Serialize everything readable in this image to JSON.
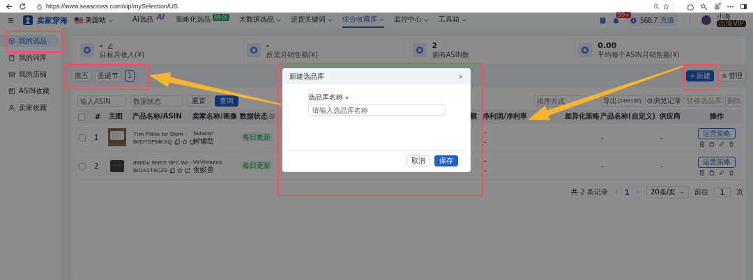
{
  "browser": {
    "url": "https://www.seascross.com/vip/mySelection/US"
  },
  "header": {
    "logo": "卖家穿海",
    "site": "美国站",
    "nav": [
      {
        "label": "AI选品",
        "badge": "AI",
        "caret": false,
        "selected": false
      },
      {
        "label": "策略化选品",
        "badge": "独创",
        "caret": false,
        "selected": false
      },
      {
        "label": "大数据选品",
        "caret": true,
        "selected": false
      },
      {
        "label": "进货关键词",
        "caret": true,
        "selected": false
      },
      {
        "label": "综合收藏库",
        "caret": true,
        "selected": true
      },
      {
        "label": "监控中心",
        "caret": true,
        "selected": false
      },
      {
        "label": "工具箱",
        "caret": true,
        "selected": false
      }
    ],
    "notifications": "99+",
    "balance": "568.7",
    "recharge": "充值",
    "user": "小海",
    "vip": "出海VIP"
  },
  "sidebar": {
    "items": [
      {
        "label": "我的选品",
        "selected": true
      },
      {
        "label": "我的词库",
        "selected": false
      },
      {
        "label": "我的店铺",
        "selected": false
      },
      {
        "label": "ASIN收藏",
        "selected": false
      },
      {
        "label": "卖家收藏",
        "selected": false
      }
    ]
  },
  "stats": [
    {
      "value": "-",
      "label": "目标月收入(¥)",
      "editable": true
    },
    {
      "value": "-",
      "label": "所需月销售额(¥)",
      "editable": false
    },
    {
      "value": "2",
      "label": "拥有ASIN数",
      "editable": false
    },
    {
      "value": "0.00",
      "label": "平均每个ASIN月销售额(¥)",
      "editable": false
    }
  ],
  "tags": [
    {
      "label": "黑五",
      "selected": false
    },
    {
      "label": "圣诞节",
      "selected": false
    },
    {
      "label": "1",
      "selected": true
    }
  ],
  "actions": {
    "new": "新建",
    "manage": "管理"
  },
  "filters": {
    "asin_placeholder": "输入ASIN",
    "status_placeholder": "数据状态",
    "reset": "重置",
    "search": "查询",
    "sort_placeholder": "排序方式",
    "export": "导出",
    "export_count": "(149/150)",
    "history": "浏览记录",
    "transfer": "转移选品库",
    "delete": "删除",
    "transfer_disabled": true,
    "delete_disabled": true
  },
  "table": {
    "header_checked": false,
    "columns": [
      "#",
      "主图",
      "产品名称/ASIN",
      "卖家名称/画像",
      "数据状态",
      "额",
      "净利润/净利率",
      "差异化策略",
      "产品名称(自定义)",
      "供应商",
      "操作"
    ],
    "rows": [
      {
        "checked": false,
        "index": "1",
        "name": "Thin Pillow for Stom···",
        "asin": "B0DYDPMKXQ",
        "seller": "Suhedy*",
        "persona": "树懒型",
        "status": "每日更新",
        "profit": "-",
        "margin": "-",
        "custom_name": "-",
        "supplier": "-",
        "op": "运营策略"
      },
      {
        "checked": false,
        "index": "2",
        "name": "8BitDo SNES SFC Wi···",
        "asin": "B01K1T9CZS",
        "seller": "VirVentures",
        "persona": "食蚁兽",
        "status": "每日更新",
        "profit": "-",
        "margin": "-",
        "custom_name": "-",
        "supplier": "-",
        "op": "运营策略"
      }
    ]
  },
  "pagination": {
    "total": "共 2 条记录",
    "pages": [
      {
        "label": "1",
        "selected": true
      }
    ],
    "page_size": "20条/页",
    "goto": "前往",
    "goto_value": "1",
    "page_unit": "页"
  },
  "modal": {
    "title": "新建选品库",
    "field_label": "选品库名称",
    "required": true,
    "placeholder": "请输入选品库名称",
    "cancel": "取消",
    "save": "保存"
  }
}
